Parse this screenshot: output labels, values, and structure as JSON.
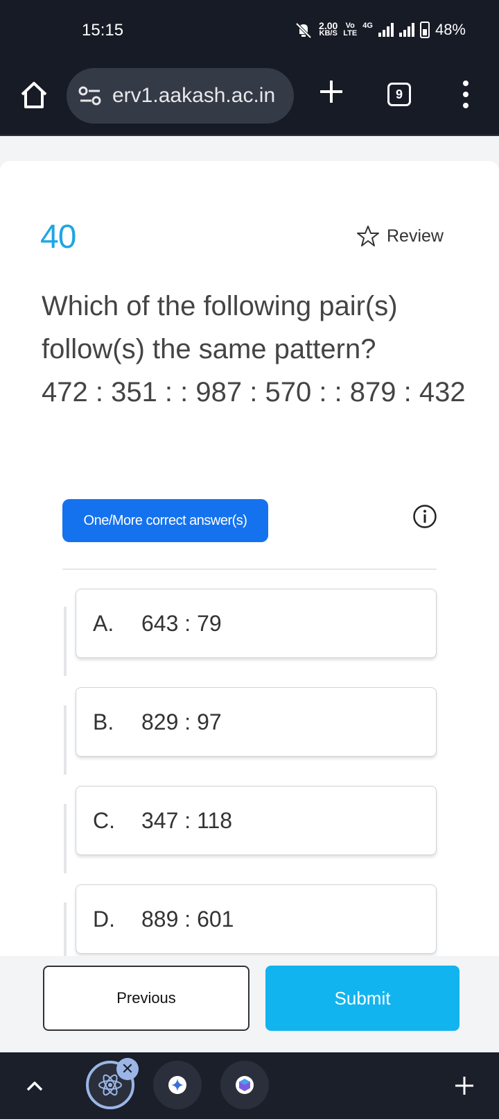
{
  "status_bar": {
    "time": "15:15",
    "net_speed_value": "2.00",
    "net_speed_unit": "KB/S",
    "volte_top": "Vo",
    "volte_bottom": "LTE",
    "network": "4G",
    "battery": "48%"
  },
  "browser": {
    "url": "erv1.aakash.ac.in",
    "tab_count": "9"
  },
  "question": {
    "number": "40",
    "review_label": "Review",
    "text_line1": "Which of the following pair(s)",
    "text_line2": "follow(s) the same pattern?",
    "text_line3": "472 : 351 : : 987 : 570 : : 879 : 432",
    "answer_type": "One/More correct answer(s)",
    "options": [
      {
        "letter": "A.",
        "text": "643 : 79"
      },
      {
        "letter": "B.",
        "text": "829 : 97"
      },
      {
        "letter": "C.",
        "text": "347 : 118"
      },
      {
        "letter": "D.",
        "text": "889 : 601"
      }
    ]
  },
  "actions": {
    "previous_label": "Previous",
    "submit_label": "Submit"
  },
  "colors": {
    "accent": "#1ea6e4",
    "badge": "#1572ee",
    "submit": "#12b4ef",
    "chrome": "#171b26"
  }
}
